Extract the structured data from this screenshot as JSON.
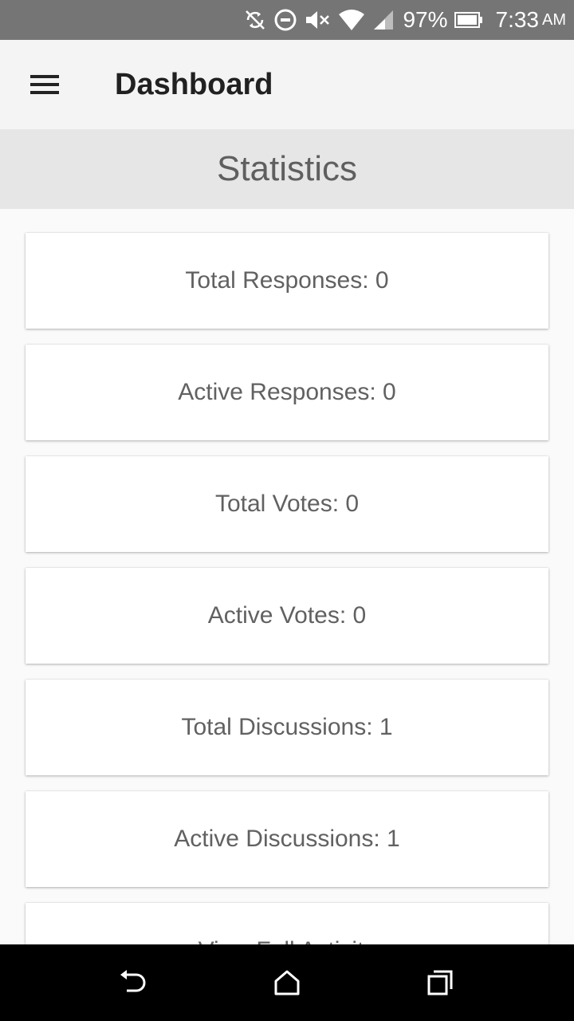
{
  "status_bar": {
    "battery": "97%",
    "time": "7:33",
    "ampm": "AM",
    "icons": [
      "sync-disabled-icon",
      "do-not-disturb-icon",
      "volume-muted-icon",
      "wifi-icon",
      "cell-signal-icon",
      "battery-icon"
    ]
  },
  "app_bar": {
    "title": "Dashboard",
    "menu_icon": "menu-icon"
  },
  "section": {
    "title": "Statistics"
  },
  "cards": [
    {
      "label": "Total Responses: 0"
    },
    {
      "label": "Active Responses: 0"
    },
    {
      "label": "Total Votes: 0"
    },
    {
      "label": "Active Votes: 0"
    },
    {
      "label": "Total Discussions: 1"
    },
    {
      "label": "Active Discussions: 1"
    },
    {
      "label": "View Full Activity"
    }
  ],
  "nav_bar": {
    "icons": [
      "back-icon",
      "home-icon",
      "recents-icon"
    ]
  },
  "colors": {
    "status_bar": "#757575",
    "app_bar": "#f4f4f4",
    "section_header": "#e6e6e6",
    "background": "#fafafa",
    "card": "#ffffff",
    "nav_bar": "#000000"
  }
}
